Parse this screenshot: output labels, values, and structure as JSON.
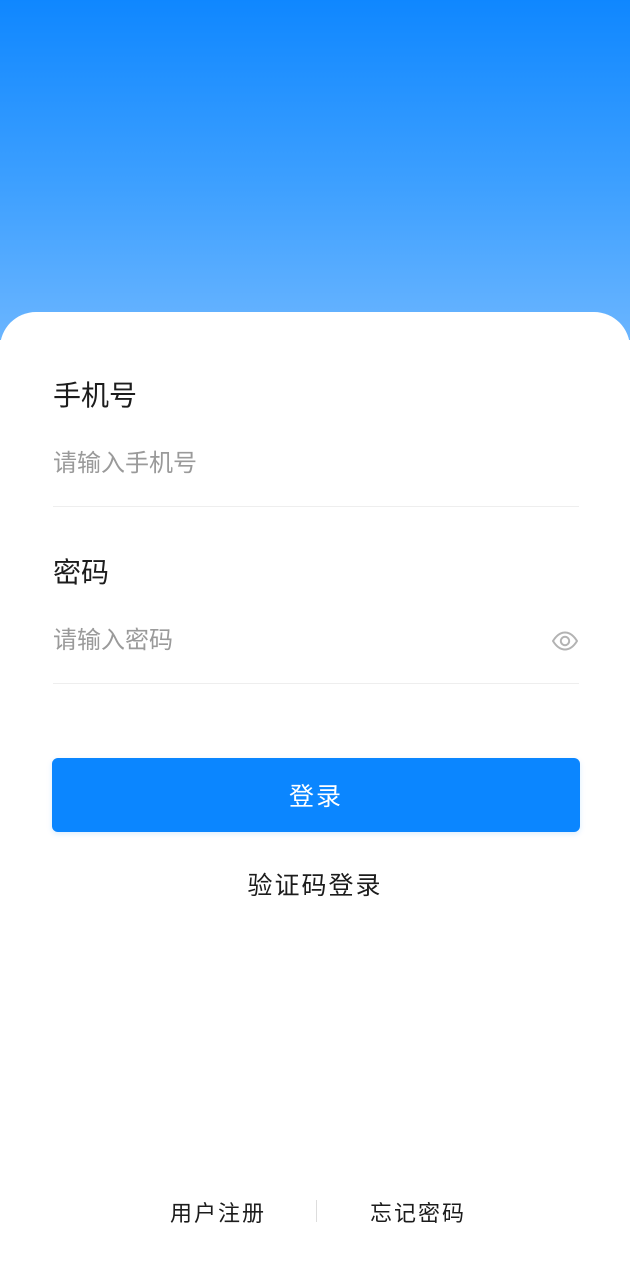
{
  "header": {
    "gradient_top": "#0f87ff",
    "gradient_bottom": "#6ab5ff"
  },
  "form": {
    "phone": {
      "label": "手机号",
      "placeholder": "请输入手机号",
      "value": ""
    },
    "password": {
      "label": "密码",
      "placeholder": "请输入密码",
      "value": "",
      "toggle_icon": "eye-icon"
    }
  },
  "actions": {
    "login_label": "登录",
    "login_color": "#0b86ff",
    "sms_login_label": "验证码登录"
  },
  "footer": {
    "register_label": "用户注册",
    "forgot_label": "忘记密码"
  }
}
